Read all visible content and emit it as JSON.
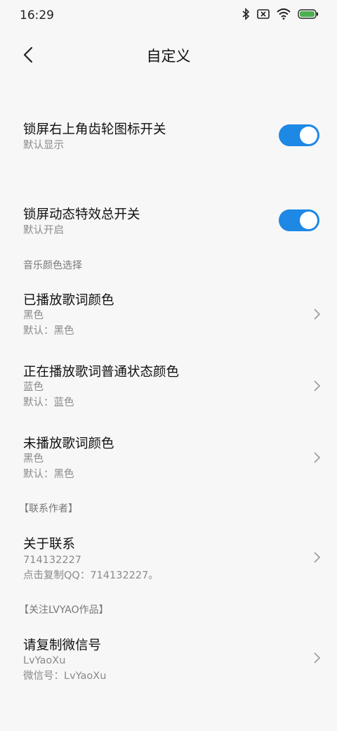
{
  "status_bar": {
    "time": "16:29",
    "icons": [
      "bluetooth-icon",
      "battery-saver-x-icon",
      "wifi-icon",
      "battery-icon"
    ],
    "battery_color": "#4caf50"
  },
  "header": {
    "title": "自定义",
    "back_icon": "chevron-left-icon"
  },
  "toggles": [
    {
      "title": "锁屏右上角齿轮图标开关",
      "subtitle": "默认显示",
      "on": true
    },
    {
      "title": "锁屏动态特效总开关",
      "subtitle": "默认开启",
      "on": true
    }
  ],
  "sections": {
    "music_color": "音乐颜色选择",
    "contact_author": "【联系作者】",
    "follow": "【关注LVYAO作品】"
  },
  "color_items": [
    {
      "title": "已播放歌词颜色",
      "value": "黑色",
      "default": "默认：黑色"
    },
    {
      "title": "正在播放歌词普通状态颜色",
      "value": "蓝色",
      "default": "默认：蓝色"
    },
    {
      "title": "未播放歌词颜色",
      "value": "黑色",
      "default": "默认：黑色"
    }
  ],
  "contact": {
    "title": "关于联系",
    "value": "714132227",
    "note": "点击复制QQ：714132227。"
  },
  "wechat": {
    "title": "请复制微信号",
    "value": "LvYaoXu",
    "note": "微信号：LvYaoXu"
  },
  "accent_color": "#1e88e5"
}
